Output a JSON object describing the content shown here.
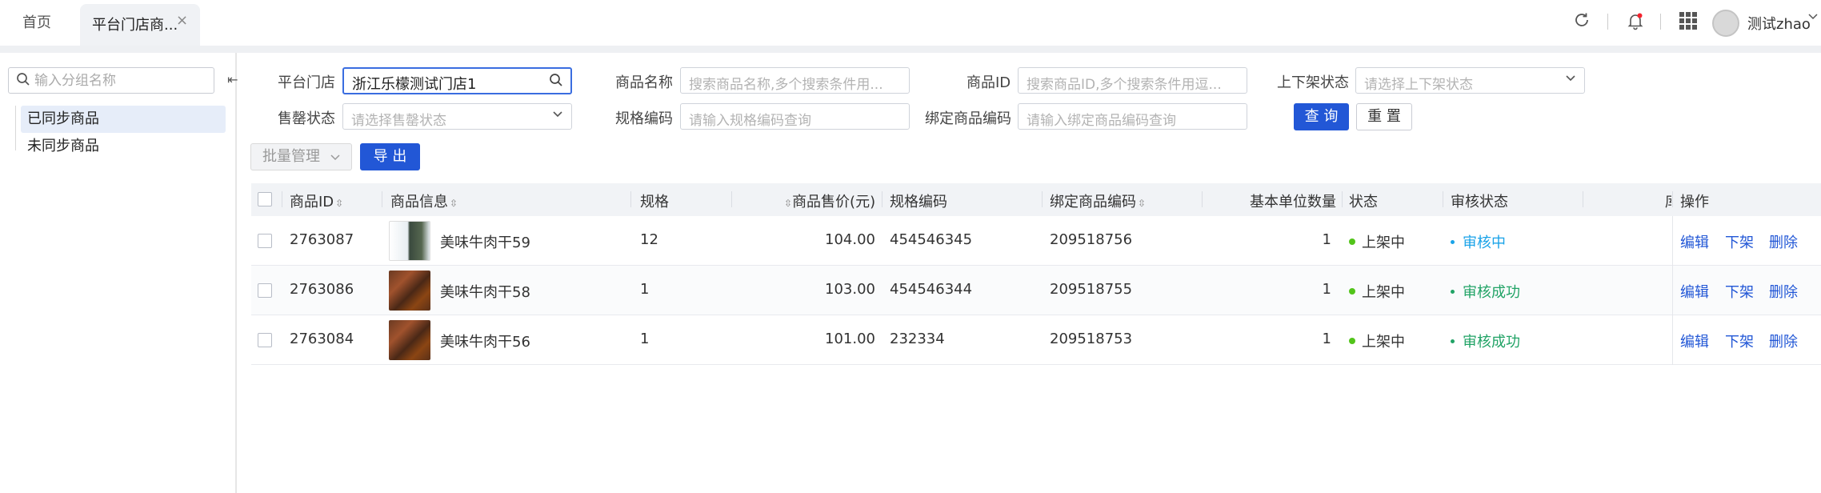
{
  "tabs": {
    "home": "首页",
    "active": "平台门店商...",
    "close": "×"
  },
  "header": {
    "username": "测试zhao"
  },
  "sidebar": {
    "search_placeholder": "输入分组名称",
    "collapse_glyph": "⇤",
    "items": [
      {
        "label": "已同步商品",
        "active": true
      },
      {
        "label": "未同步商品",
        "active": false
      }
    ]
  },
  "filters": {
    "store_label": "平台门店",
    "store_value": "浙江乐檬测试门店1",
    "name_label": "商品名称",
    "name_placeholder": "搜索商品名称,多个搜索条件用...",
    "id_label": "商品ID",
    "id_placeholder": "搜索商品ID,多个搜索条件用逗...",
    "shelf_label": "上下架状态",
    "shelf_placeholder": "请选择上下架状态",
    "soldout_label": "售罄状态",
    "soldout_placeholder": "请选择售罄状态",
    "spec_label": "规格编码",
    "spec_placeholder": "请输入规格编码查询",
    "bind_label": "绑定商品编码",
    "bind_placeholder": "请输入绑定商品编码查询",
    "query_button": "查 询",
    "reset_button": "重 置"
  },
  "toolbar": {
    "batch_label": "批量管理",
    "export_label": "导 出"
  },
  "table": {
    "headers": {
      "id": "商品ID",
      "info": "商品信息",
      "spec": "规格",
      "price": "商品售价(元)",
      "spec_code": "规格编码",
      "bind_code": "绑定商品编码",
      "unit_qty": "基本单位数量",
      "status": "状态",
      "audit": "审核状态",
      "truncated": "库",
      "ops": "操作"
    },
    "rows": [
      {
        "id": "2763087",
        "name": "美味牛肉干59",
        "spec": "12",
        "price": "104.00",
        "spec_code": "454546345",
        "bind_code": "209518756",
        "unit_qty": "1",
        "status": "上架中",
        "audit": "审核中",
        "audit_color": "#1aa3e8",
        "thumb": "phone"
      },
      {
        "id": "2763086",
        "name": "美味牛肉干58",
        "spec": "1",
        "price": "103.00",
        "spec_code": "454546344",
        "bind_code": "209518755",
        "unit_qty": "1",
        "status": "上架中",
        "audit": "审核成功",
        "audit_color": "#21a366",
        "thumb": "meat"
      },
      {
        "id": "2763084",
        "name": "美味牛肉干56",
        "spec": "1",
        "price": "101.00",
        "spec_code": "232334",
        "bind_code": "209518753",
        "unit_qty": "1",
        "status": "上架中",
        "audit": "审核成功",
        "audit_color": "#21a366",
        "thumb": "meat"
      }
    ],
    "actions": {
      "edit": "编辑",
      "offshelf": "下架",
      "delete": "删除"
    }
  },
  "colors": {
    "primary": "#2257d6",
    "success": "#52c41a"
  }
}
